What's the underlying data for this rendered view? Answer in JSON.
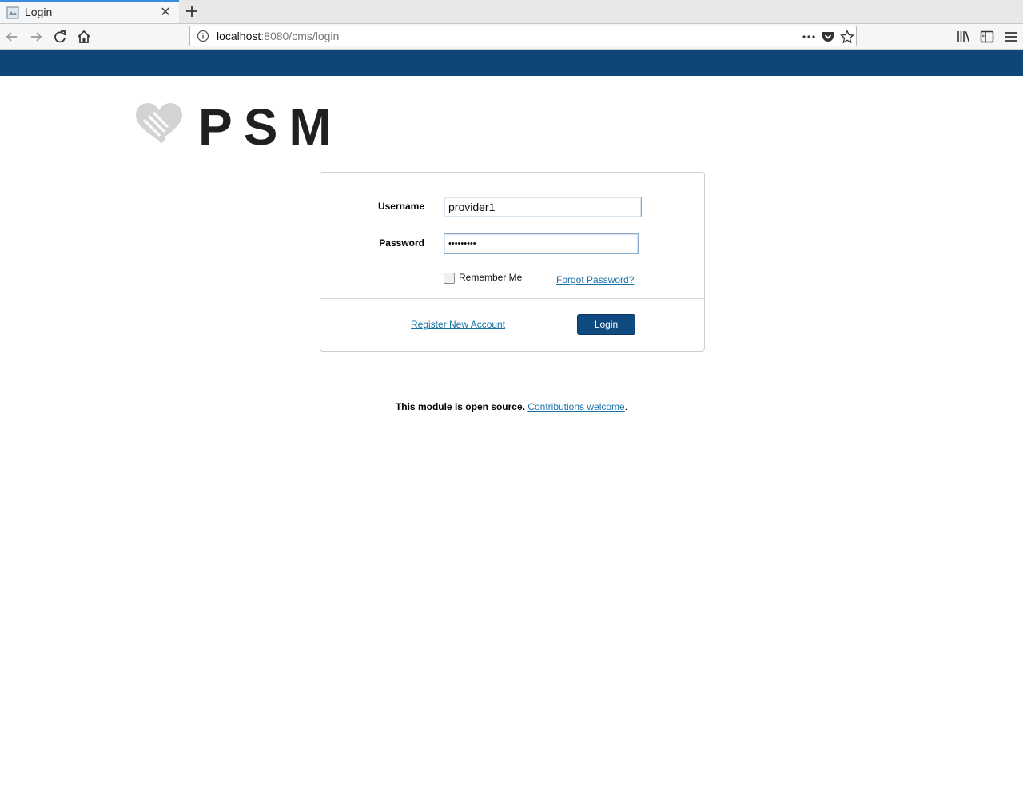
{
  "browser": {
    "tab_title": "Login",
    "url_host": "localhost",
    "url_rest": ":8080/cms/login"
  },
  "colors": {
    "header_band": "#0e4677",
    "button": "#0f4a80",
    "link": "#1a73a8"
  },
  "logo": {
    "text": "PSM"
  },
  "login": {
    "username_label": "Username",
    "username_value": "provider1",
    "password_label": "Password",
    "password_value": "•••••••••",
    "remember_label": "Remember Me",
    "forgot_link": "Forgot Password?",
    "register_link": "Register New Account",
    "login_button": "Login"
  },
  "footer": {
    "text": "This module is open source.",
    "link": "Contributions welcome",
    "trailing": "."
  }
}
